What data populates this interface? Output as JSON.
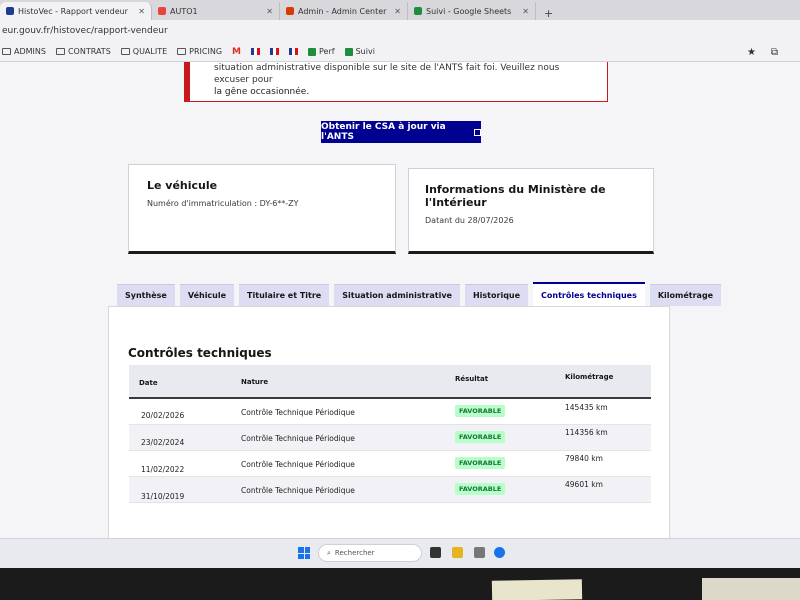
{
  "browser": {
    "tabs": [
      {
        "label": "HistoVec - Rapport vendeur",
        "color": "#1f3a93"
      },
      {
        "label": "AUTO1",
        "color": "#e8453c"
      },
      {
        "label": "Admin - Admin Center",
        "color": "#d83b01"
      },
      {
        "label": "Suivi - Google Sheets",
        "color": "#1e8e3e"
      }
    ],
    "address": "eur.gouv.fr/histovec/rapport-vendeur",
    "bookmarks": [
      "ADMINS",
      "CONTRATS",
      "QUALITE",
      "PRICING",
      "Perf",
      "Suivi"
    ]
  },
  "page": {
    "alert_line1": "situation administrative disponible sur le site de l'ANTS fait foi. Veuillez nous excuser pour",
    "alert_line2": "la gêne occasionnée.",
    "cta_label": "Obtenir le CSA à jour via l'ANTS",
    "vehicle_card": {
      "title": "Le véhicule",
      "text": "Numéro d'immatriculation : DY-6**-ZY"
    },
    "ministry_card": {
      "title": "Informations du Ministère de l'Intérieur",
      "text": "Datant du 28/07/2026"
    },
    "tabs": [
      "Synthèse",
      "Véhicule",
      "Titulaire et Titre",
      "Situation administrative",
      "Historique",
      "Contrôles techniques",
      "Kilométrage"
    ],
    "active_tab": "Contrôles techniques",
    "section_title": "Contrôles techniques",
    "table": {
      "headers": [
        "Date",
        "Nature",
        "Résultat",
        "Kilométrage"
      ],
      "rows": [
        {
          "date": "20/02/2026",
          "nature": "Contrôle Technique Périodique",
          "result": "FAVORABLE",
          "km": "145435 km"
        },
        {
          "date": "23/02/2024",
          "nature": "Contrôle Technique Périodique",
          "result": "FAVORABLE",
          "km": "114356 km"
        },
        {
          "date": "11/02/2022",
          "nature": "Contrôle Technique Périodique",
          "result": "FAVORABLE",
          "km": "79840 km"
        },
        {
          "date": "31/10/2019",
          "nature": "Contrôle Technique Périodique",
          "result": "FAVORABLE",
          "km": "49601 km"
        }
      ]
    }
  },
  "taskbar": {
    "search_placeholder": "Rechercher"
  },
  "colors": {
    "primary": "#000091",
    "alert": "#c9191e",
    "badge_bg": "#b8fec9",
    "badge_text": "#18753c"
  }
}
